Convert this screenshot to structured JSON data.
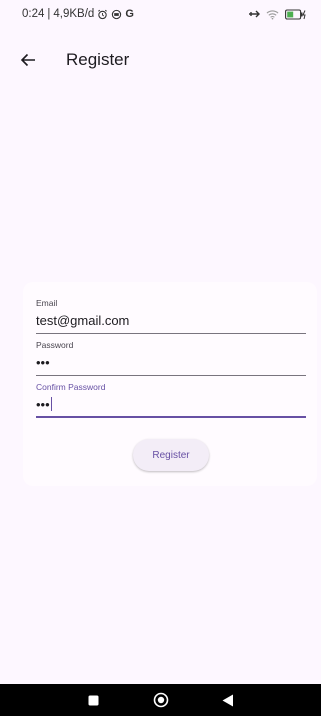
{
  "status_bar": {
    "time": "0:24",
    "separator": "|",
    "network_speed": "4,9KB/d",
    "icons": [
      "alarm-icon",
      "cast-icon",
      "google-icon",
      "airplane-icon",
      "wifi-icon",
      "battery-icon"
    ],
    "google_letter": "G"
  },
  "app_bar": {
    "title": "Register",
    "back_icon": "arrow-left-icon"
  },
  "form": {
    "email": {
      "label": "Email",
      "value": "test@gmail.com"
    },
    "password": {
      "label": "Password",
      "value": "•••"
    },
    "confirm_password": {
      "label": "Confirm Password",
      "value": "•••"
    },
    "register_label": "Register"
  },
  "nav_bar": {
    "icons": [
      "recents-square-icon",
      "home-circle-icon",
      "back-triangle-icon"
    ]
  },
  "colors": {
    "background": "#fdf7ff",
    "card": "#fffbff",
    "primary": "#6750a4",
    "button_bg": "#f3edf7"
  }
}
